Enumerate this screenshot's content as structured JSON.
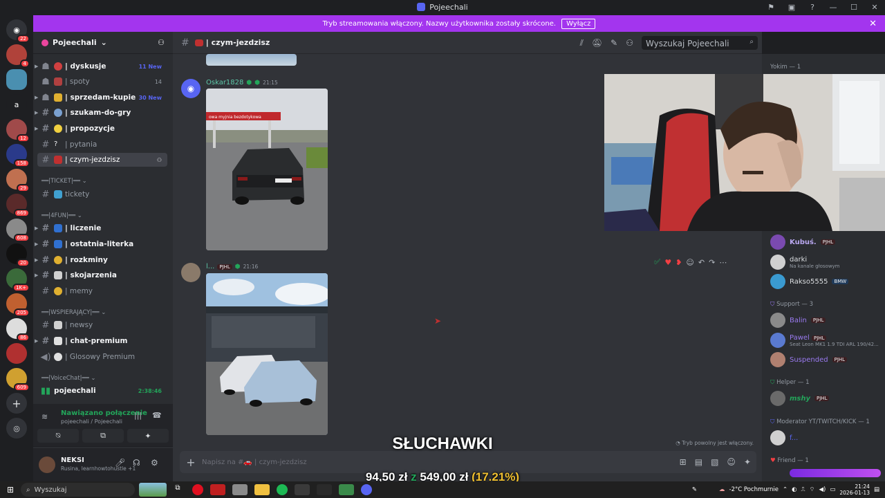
{
  "window": {
    "title": "Pojeechali"
  },
  "banner": {
    "text": "Tryb streamowania włączony. Nazwy użytkownika zostały skrócone.",
    "button": "Wyłącz"
  },
  "server_rail": {
    "badges": [
      "22",
      "4",
      "12",
      "158",
      "29",
      "869",
      "608",
      "20",
      "1K+",
      "205",
      "86",
      "609"
    ],
    "home_letter": "a"
  },
  "guild": {
    "name": "Pojeechali"
  },
  "channels": [
    {
      "name": "| dyskusje",
      "count": "11 New"
    },
    {
      "name": "| spoty",
      "count": "14"
    },
    {
      "name": "| sprzedam-kupie",
      "count": "30 New"
    },
    {
      "name": "| szukam-do-gry",
      "count": ""
    },
    {
      "name": "| propozycje",
      "count": ""
    },
    {
      "name": "| pytania",
      "count": ""
    },
    {
      "name": "| czym-jezdzisz",
      "count": ""
    },
    {
      "name": "tickety",
      "count": ""
    },
    {
      "name": "| liczenie",
      "count": ""
    },
    {
      "name": "| ostatnia-literka",
      "count": ""
    },
    {
      "name": "| rozkminy",
      "count": ""
    },
    {
      "name": "| skojarzenia",
      "count": ""
    },
    {
      "name": "| memy",
      "count": ""
    },
    {
      "name": "| newsy",
      "count": ""
    },
    {
      "name": "| chat-premium",
      "count": ""
    },
    {
      "name": "| Glosowy Premium",
      "count": ""
    },
    {
      "name": "pojeechali",
      "count": "2:38:46"
    }
  ],
  "categories": [
    "══|TICKET|══",
    "══|4FUN|══",
    "══|WSPIERAJĄCY|══",
    "══|VoiceChat|══"
  ],
  "voice": {
    "status": "Nawiązano połączenie",
    "location": "pojeechali / Pojeechali"
  },
  "user": {
    "name": "NEKSI",
    "status": "Rusina, learnhowtohustle +1"
  },
  "channel_header": {
    "name": "| czym-jezdzisz",
    "search_placeholder": "Wyszukaj Pojeechali"
  },
  "messages": [
    {
      "user": "Oskar1828",
      "time": "21:15",
      "tag": ""
    },
    {
      "user": "l...",
      "time": "21:16",
      "tag": "PJHL"
    }
  ],
  "photo1_sign": "owa myjnia bezdotykowa",
  "composer": {
    "placeholder": "Napisz na #🚗 | czym-jezdzisz",
    "slowmode": "Tryb powolny jest włączony."
  },
  "members": {
    "groups": [
      "Yokim — 1",
      "Support — 3",
      "Helper — 1",
      "Moderator YT/TWITCH/KICK — 1",
      "Friend — 1"
    ],
    "list": [
      {
        "name": "Kubuś.",
        "tag": "PJHL",
        "status": ""
      },
      {
        "name": "darki",
        "tag": "",
        "status": "Na kanale głosowym"
      },
      {
        "name": "Rakso5555",
        "tag": "BMW",
        "status": ""
      },
      {
        "name": "Balin",
        "tag": "PJHL",
        "status": ""
      },
      {
        "name": "Pawel",
        "tag": "PJHL",
        "status": "Seat Leon MK1 1.9 TDI ARL 190/42..."
      },
      {
        "name": "Suspended",
        "tag": "PJHL",
        "status": ""
      },
      {
        "name": "mshy",
        "tag": "PJHL",
        "status": ""
      },
      {
        "name": "f...",
        "tag": "",
        "status": ""
      }
    ]
  },
  "overlay": {
    "headline": "SŁUCHAWKI",
    "price_from": "94,50 zł",
    "price_z": "z",
    "price_to": "549,00 zł",
    "percent": "(17.21%)"
  },
  "taskbar": {
    "search": "Wyszukaj",
    "weather": "-2°C  Pochmurnie",
    "time": "21:24",
    "date": "2026-01-13"
  },
  "colors": {
    "accent": "#5865f2",
    "banner": "#a335ee",
    "green": "#23a55a",
    "red": "#f23f43"
  }
}
